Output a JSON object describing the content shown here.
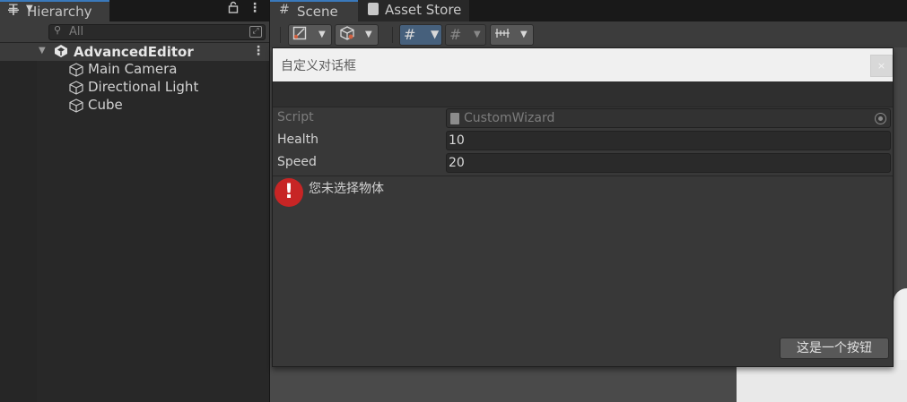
{
  "hierarchy": {
    "tab_label": "Hierarchy",
    "add_symbol": "+",
    "search_placeholder": "All",
    "scene_name": "AdvancedEditor",
    "items": [
      {
        "label": "Main Camera"
      },
      {
        "label": "Directional Light"
      },
      {
        "label": "Cube"
      }
    ]
  },
  "scene": {
    "tabs": [
      {
        "label": "Scene"
      },
      {
        "label": "Asset Store"
      }
    ]
  },
  "dialog": {
    "title": "自定义对话框",
    "close_symbol": "×",
    "fields": [
      {
        "label": "Script",
        "value": "CustomWizard"
      },
      {
        "label": "Health",
        "value": "10"
      },
      {
        "label": "Speed",
        "value": "20"
      }
    ],
    "error_icon": "!",
    "error_message": "您未选择物体",
    "button_label": "这是一个按钮"
  },
  "colors": {
    "accent": "#3a79bb",
    "error": "#c72525",
    "panel": "#282828",
    "dialog_bg": "#383838"
  }
}
